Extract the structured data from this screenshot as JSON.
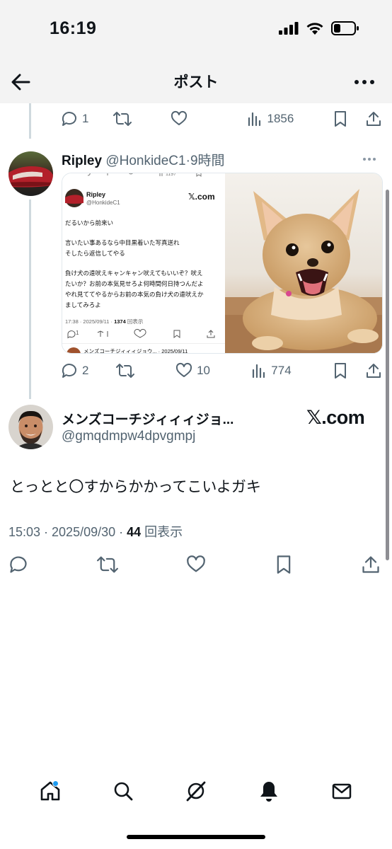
{
  "status_bar": {
    "time": "16:19"
  },
  "header": {
    "title": "ポスト"
  },
  "parent_tweet_actions": {
    "replies": "1",
    "views": "1856"
  },
  "reply_tweet": {
    "name": "Ripley",
    "handle": "@HonkideC1",
    "separator": "·",
    "time": "9時間",
    "replies": "2",
    "likes": "10",
    "views": "774",
    "embedded_screenshot": {
      "top_views": "1197",
      "name": "Ripley",
      "handle": "@HonkideC1",
      "logo": "𝕏.com",
      "lines": [
        "だるいから前来い",
        "",
        "言いたい事あるなら中目黒着いた写真送れ",
        "そしたら返信してやる",
        "",
        "負け犬の遠吠えキャンキャン吠えてもいいぞ？吠え",
        "たいか？お前の本気見せろよ何時間何日持つんだよ",
        "やれ見ててやるからお前の本気の負け犬の遠吠えか",
        "ましてみろよ"
      ],
      "meta_prefix": "17:38 · 2025/09/11 · ",
      "meta_views": "1374",
      "meta_suffix": " 回表示",
      "reply_count": "1",
      "bottom_line": "メンズコーチジィィィジョウ... · 2025/09/11"
    }
  },
  "main_tweet": {
    "name": "メンズコーチジィィィジョ...",
    "handle": "@gmqdmpw4dpvgmpj",
    "logo": "𝕏.com",
    "text": "とっとと〇すからかかってこいよガキ",
    "meta_prefix": "15:03 · 2025/09/30 · ",
    "views": "44",
    "views_suffix": " 回表示"
  },
  "bottom_nav": {
    "items": [
      "home-icon",
      "search-icon",
      "grok-icon",
      "notifications-icon",
      "messages-icon"
    ],
    "accent": "#1d9bf0"
  }
}
